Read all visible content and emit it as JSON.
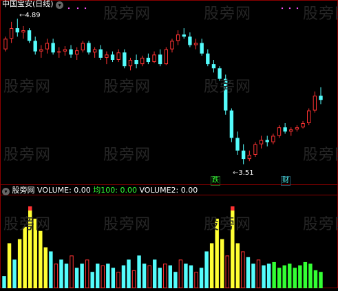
{
  "top_panel": {
    "title": "中国宝安(日线)",
    "high_marker": "4.89",
    "low_marker": "3.51",
    "tag_down": "跌",
    "tag_cai": "财"
  },
  "bottom_panel": {
    "indicator_name": "股旁网",
    "volume_label": "VOLUME: 0.00",
    "avg_label": "均100: 0.00",
    "volume2_label": "VOLUME2: 0.00"
  },
  "watermark": "股旁网",
  "colors": {
    "up": "#ff3333",
    "down": "#54fcfc",
    "yellow": "#ffff33",
    "green": "#33ff33",
    "pink": "#ff3333",
    "grid": "#8b0000",
    "magenta": "#ff55ff",
    "avg_label": "#33ff33"
  },
  "chart_data": [
    {
      "type": "candlestick",
      "title": "中国宝安(日线)",
      "annotations": [
        "4.89",
        "3.51",
        "跌",
        "财"
      ],
      "candles": [
        [
          4.6,
          4.72,
          4.58,
          4.7
        ],
        [
          4.7,
          4.86,
          4.66,
          4.8
        ],
        [
          4.8,
          4.89,
          4.72,
          4.76
        ],
        [
          4.76,
          4.82,
          4.7,
          4.78
        ],
        [
          4.78,
          4.8,
          4.66,
          4.68
        ],
        [
          4.68,
          4.72,
          4.55,
          4.58
        ],
        [
          4.58,
          4.64,
          4.52,
          4.6
        ],
        [
          4.6,
          4.7,
          4.56,
          4.66
        ],
        [
          4.66,
          4.7,
          4.55,
          4.57
        ],
        [
          4.57,
          4.62,
          4.52,
          4.58
        ],
        [
          4.58,
          4.63,
          4.54,
          4.6
        ],
        [
          4.6,
          4.64,
          4.52,
          4.55
        ],
        [
          4.55,
          4.62,
          4.5,
          4.59
        ],
        [
          4.59,
          4.68,
          4.57,
          4.66
        ],
        [
          4.66,
          4.68,
          4.55,
          4.57
        ],
        [
          4.57,
          4.62,
          4.52,
          4.6
        ],
        [
          4.6,
          4.64,
          4.5,
          4.52
        ],
        [
          4.52,
          4.58,
          4.46,
          4.55
        ],
        [
          4.55,
          4.58,
          4.48,
          4.5
        ],
        [
          4.5,
          4.6,
          4.48,
          4.57
        ],
        [
          4.57,
          4.6,
          4.42,
          4.44
        ],
        [
          4.44,
          4.52,
          4.4,
          4.5
        ],
        [
          4.5,
          4.55,
          4.42,
          4.46
        ],
        [
          4.46,
          4.54,
          4.44,
          4.52
        ],
        [
          4.52,
          4.56,
          4.46,
          4.48
        ],
        [
          4.48,
          4.58,
          4.47,
          4.55
        ],
        [
          4.55,
          4.6,
          4.44,
          4.46
        ],
        [
          4.46,
          4.62,
          4.45,
          4.6
        ],
        [
          4.6,
          4.7,
          4.57,
          4.68
        ],
        [
          4.68,
          4.78,
          4.64,
          4.74
        ],
        [
          4.74,
          4.8,
          4.7,
          4.72
        ],
        [
          4.72,
          4.76,
          4.62,
          4.64
        ],
        [
          4.64,
          4.7,
          4.6,
          4.66
        ],
        [
          4.66,
          4.7,
          4.54,
          4.56
        ],
        [
          4.56,
          4.6,
          4.44,
          4.46
        ],
        [
          4.46,
          4.5,
          4.38,
          4.42
        ],
        [
          4.42,
          4.44,
          4.3,
          4.32
        ],
        [
          4.32,
          4.36,
          3.98,
          4.02
        ],
        [
          4.02,
          4.04,
          3.72,
          3.76
        ],
        [
          3.76,
          3.82,
          3.6,
          3.64
        ],
        [
          3.64,
          3.7,
          3.51,
          3.56
        ],
        [
          3.56,
          3.64,
          3.54,
          3.6
        ],
        [
          3.6,
          3.72,
          3.58,
          3.7
        ],
        [
          3.7,
          3.78,
          3.66,
          3.74
        ],
        [
          3.74,
          3.78,
          3.68,
          3.72
        ],
        [
          3.72,
          3.8,
          3.7,
          3.78
        ],
        [
          3.78,
          3.88,
          3.76,
          3.86
        ],
        [
          3.86,
          3.9,
          3.8,
          3.82
        ],
        [
          3.82,
          3.86,
          3.78,
          3.84
        ],
        [
          3.84,
          3.88,
          3.82,
          3.86
        ],
        [
          3.86,
          3.92,
          3.85,
          3.9
        ],
        [
          3.9,
          4.04,
          3.88,
          4.02
        ],
        [
          4.02,
          4.2,
          4.0,
          4.16
        ],
        [
          4.16,
          4.24,
          4.08,
          4.12
        ]
      ]
    },
    {
      "type": "bar",
      "title": "VOLUME",
      "series": [
        {
          "name": "VOLUME",
          "values": [
            0.0
          ]
        },
        {
          "name": "均100",
          "values": [
            0.0
          ]
        },
        {
          "name": "VOLUME2",
          "values": [
            0.0
          ]
        }
      ]
    }
  ]
}
